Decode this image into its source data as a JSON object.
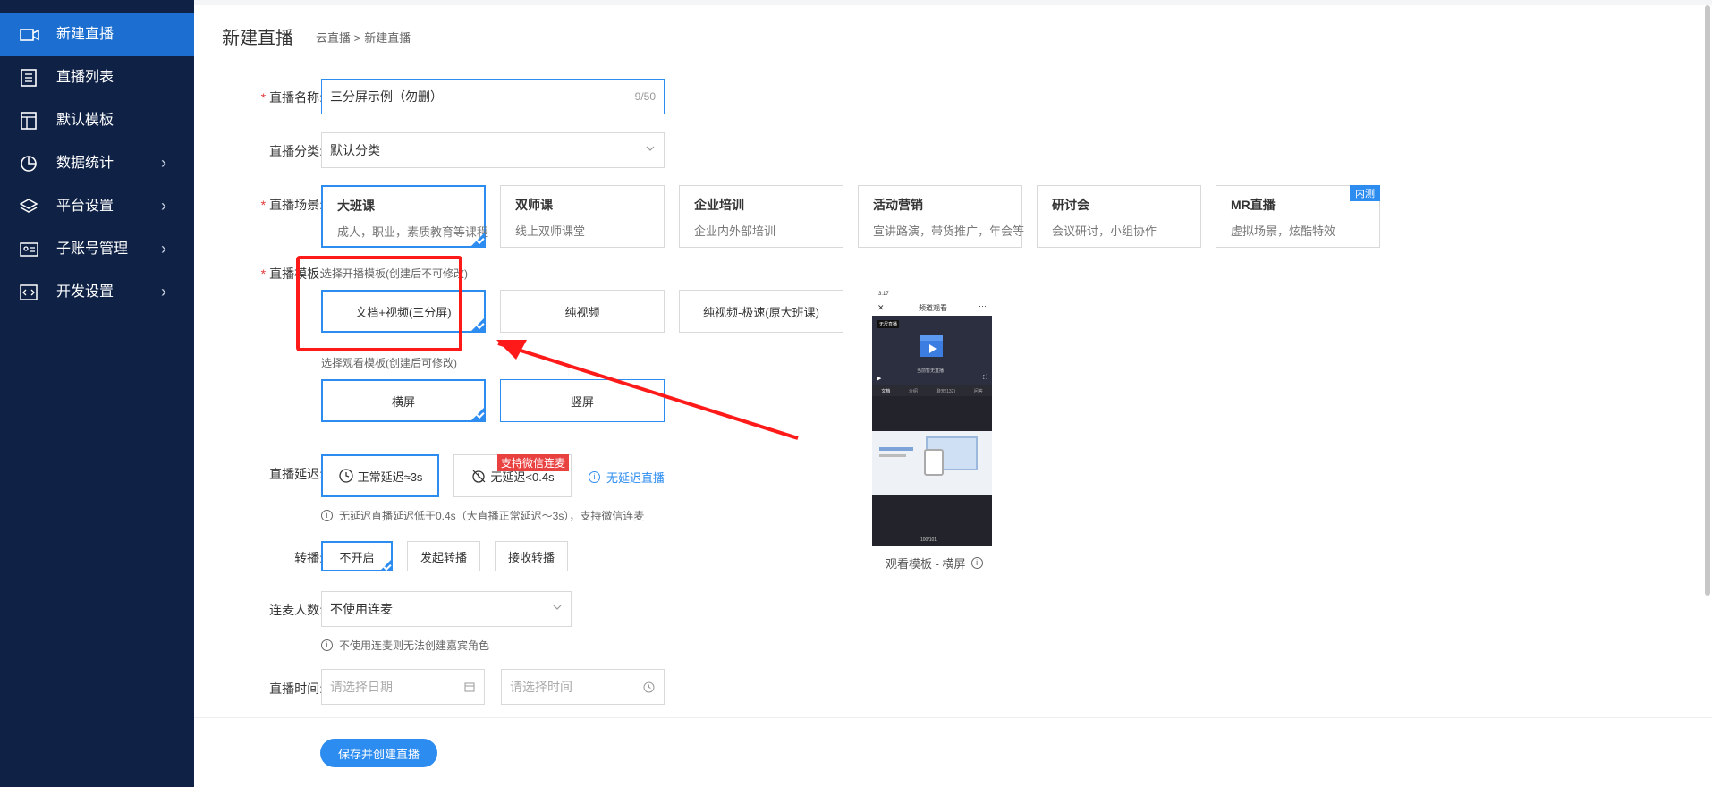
{
  "sidebar": {
    "items": [
      {
        "label": "新建直播",
        "icon": "video-camera-icon",
        "active": true,
        "expandable": false
      },
      {
        "label": "直播列表",
        "icon": "list-icon",
        "active": false,
        "expandable": false
      },
      {
        "label": "默认模板",
        "icon": "layout-icon",
        "active": false,
        "expandable": false
      },
      {
        "label": "数据统计",
        "icon": "pie-chart-icon",
        "active": false,
        "expandable": true
      },
      {
        "label": "平台设置",
        "icon": "layers-icon",
        "active": false,
        "expandable": true
      },
      {
        "label": "子账号管理",
        "icon": "id-card-icon",
        "active": false,
        "expandable": true
      },
      {
        "label": "开发设置",
        "icon": "code-icon",
        "active": false,
        "expandable": true
      }
    ],
    "chevron": "›"
  },
  "header": {
    "title": "新建直播",
    "breadcrumb": [
      "云直播 >",
      "新建直播"
    ]
  },
  "form": {
    "required_mark": "*",
    "name": {
      "label": "直播名称:",
      "value": "三分屏示例（勿删）",
      "counter": "9/50"
    },
    "category": {
      "label": "直播分类:",
      "value": "默认分类"
    },
    "scene": {
      "label": "直播场景:",
      "options": [
        {
          "title": "大班课",
          "desc": "成人，职业，素质教育等课程",
          "selected": true
        },
        {
          "title": "双师课",
          "desc": "线上双师课堂",
          "selected": false
        },
        {
          "title": "企业培训",
          "desc": "企业内外部培训",
          "selected": false
        },
        {
          "title": "活动营销",
          "desc": "宣讲路演，带货推广，年会等",
          "selected": false
        },
        {
          "title": "研讨会",
          "desc": "会议研讨，小组协作",
          "selected": false
        },
        {
          "title": "MR直播",
          "desc": "虚拟场景，炫酷特效",
          "selected": false,
          "badge": "内测"
        }
      ]
    },
    "template": {
      "label": "直播模板:",
      "broadcast_hint": "选择开播模板(创建后不可修改)",
      "broadcast_options": [
        "文档+视频(三分屏)",
        "纯视频",
        "纯视频-极速(原大班课)"
      ],
      "watch_hint": "选择观看模板(创建后可修改)",
      "watch_options": [
        "横屏",
        "竖屏"
      ]
    },
    "delay": {
      "label": "直播延迟:",
      "options": [
        "正常延迟≈3s",
        "无延迟<0.4s"
      ],
      "tag": "支持微信连麦",
      "link": "无延迟直播",
      "note": "无延迟直播延迟低于0.4s（大直播正常延迟～3s），支持微信连麦"
    },
    "relay": {
      "label": "转播:",
      "options": [
        "不开启",
        "发起转播",
        "接收转播"
      ]
    },
    "mic": {
      "label": "连麦人数:",
      "value": "不使用连麦",
      "note": "不使用连麦则无法创建嘉宾角色"
    },
    "time": {
      "label": "直播时间:",
      "date_placeholder": "请选择日期",
      "time_placeholder": "请选择时间"
    },
    "submit": "保存并创建直播"
  },
  "preview": {
    "caption": "观看模板 - 横屏",
    "status_time": "3:17",
    "title": "频道观看",
    "tabs": [
      "文档",
      "介绍",
      "聊天(132)",
      "问答"
    ],
    "video_caption": "当前暂无直播",
    "badge": "无尺直播",
    "page": "100/101"
  },
  "colors": {
    "sidebar_bg": "#0f2246",
    "active": "#1c6fd0",
    "accent": "#2d8cf0",
    "annotation": "#ff1a1a"
  }
}
